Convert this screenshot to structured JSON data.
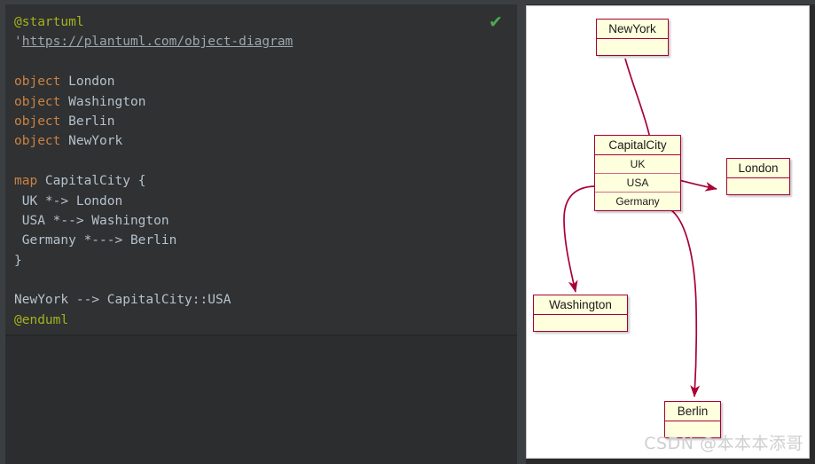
{
  "editor": {
    "status_icon": "check-icon",
    "status_icon_glyph": "✔",
    "status_color": "#4fa84f",
    "background": "#2f3133",
    "lines": [
      {
        "tokens": [
          {
            "text": "@startuml",
            "type": "tag"
          }
        ]
      },
      {
        "tokens": [
          {
            "text": "'",
            "type": "comment-quote"
          },
          {
            "text": "https://plantuml.com/object-diagram",
            "type": "comment"
          }
        ]
      },
      {
        "tokens": []
      },
      {
        "tokens": [
          {
            "text": "object",
            "type": "kw"
          },
          {
            "text": " London",
            "type": "id"
          }
        ]
      },
      {
        "tokens": [
          {
            "text": "object",
            "type": "kw"
          },
          {
            "text": " Washington",
            "type": "id"
          }
        ]
      },
      {
        "tokens": [
          {
            "text": "object",
            "type": "kw"
          },
          {
            "text": " Berlin",
            "type": "id"
          }
        ]
      },
      {
        "tokens": [
          {
            "text": "object",
            "type": "kw"
          },
          {
            "text": " NewYork",
            "type": "id"
          }
        ]
      },
      {
        "tokens": []
      },
      {
        "tokens": [
          {
            "text": "map",
            "type": "kw"
          },
          {
            "text": " CapitalCity {",
            "type": "id"
          }
        ]
      },
      {
        "tokens": [
          {
            "text": " UK *-> London",
            "type": "id"
          }
        ]
      },
      {
        "tokens": [
          {
            "text": " USA *--> Washington",
            "type": "id"
          }
        ]
      },
      {
        "tokens": [
          {
            "text": " Germany *---> Berlin",
            "type": "id"
          }
        ]
      },
      {
        "tokens": [
          {
            "text": "}",
            "type": "id"
          }
        ]
      },
      {
        "tokens": []
      },
      {
        "tokens": [
          {
            "text": "NewYork --> CapitalCity::USA",
            "type": "id"
          }
        ]
      },
      {
        "tokens": [
          {
            "text": "@enduml",
            "type": "tag"
          }
        ]
      }
    ]
  },
  "diagram": {
    "background": "#ffffff",
    "node_fill": "#feffdd",
    "node_border": "#a80036",
    "edge_color": "#a80036",
    "nodes": [
      {
        "id": "newyork",
        "title": "NewYork",
        "kind": "object",
        "rows": []
      },
      {
        "id": "london",
        "title": "London",
        "kind": "object",
        "rows": []
      },
      {
        "id": "washington",
        "title": "Washington",
        "kind": "object",
        "rows": []
      },
      {
        "id": "berlin",
        "title": "Berlin",
        "kind": "object",
        "rows": []
      },
      {
        "id": "capitalcity",
        "title": "CapitalCity",
        "kind": "map",
        "rows": [
          "UK",
          "USA",
          "Germany"
        ]
      }
    ],
    "edges": [
      {
        "from": "capitalcity.UK",
        "to": "london",
        "style": "solid-arrow"
      },
      {
        "from": "capitalcity.USA",
        "to": "washington",
        "style": "solid-arrow"
      },
      {
        "from": "capitalcity.Germany",
        "to": "berlin",
        "style": "solid-arrow"
      },
      {
        "from": "newyork",
        "to": "capitalcity.USA",
        "style": "solid-arrow"
      }
    ],
    "watermark": "CSDN @本本本添哥"
  }
}
